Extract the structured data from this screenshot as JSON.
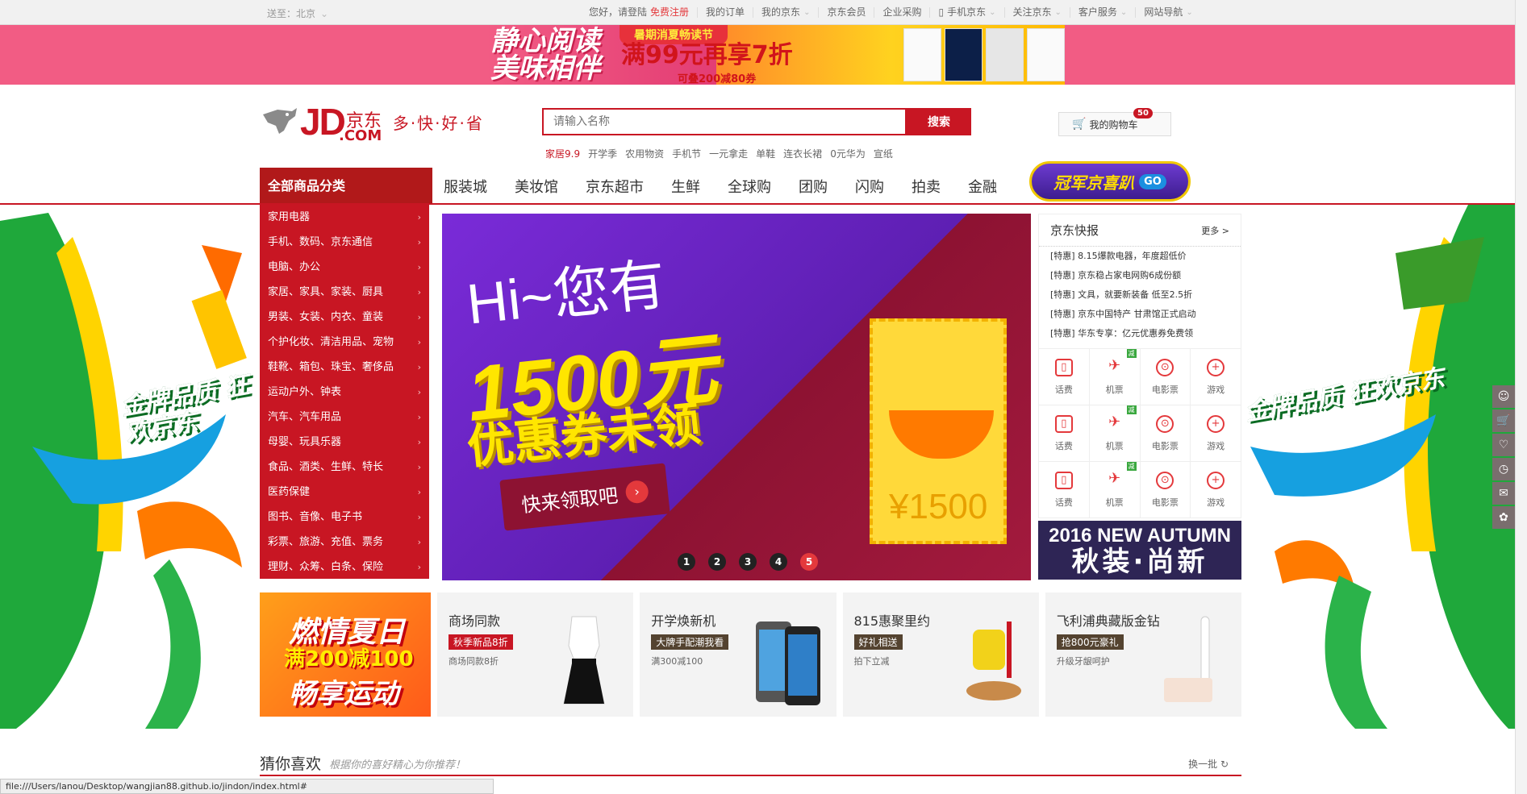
{
  "topbar": {
    "location_label": "送至：北京",
    "greeting": "您好，请登陆",
    "register": "免费注册",
    "items": [
      "我的订单",
      "我的京东",
      "京东会员",
      "企业采购",
      "手机京东",
      "关注京东",
      "客户服务",
      "网站导航"
    ]
  },
  "top_banner": {
    "line1": "静心阅读",
    "line2": "美味相伴",
    "badge": "暑期消夏畅读节",
    "offer": "满99元再享7折",
    "sub": "可叠200减80券"
  },
  "logo": {
    "mark": "JD",
    "cn": "京东",
    "com": ".COM",
    "slogan": "多·快·好·省"
  },
  "search": {
    "placeholder": "请输入名称",
    "button": "搜索"
  },
  "hotwords": [
    "家居9.9",
    "开学季",
    "农用物资",
    "手机节",
    "一元拿走",
    "单鞋",
    "连衣长裙",
    "0元华为",
    "宣纸"
  ],
  "cart": {
    "label": "我的购物车",
    "count": "50"
  },
  "nav": {
    "all_categories": "全部商品分类",
    "links": [
      "服装城",
      "美妆馆",
      "京东超市",
      "生鲜",
      "全球购",
      "团购",
      "闪购",
      "拍卖",
      "金融"
    ],
    "promo": "冠军京喜趴",
    "promo_go": "GO"
  },
  "side_deco": {
    "left": "金牌品质 狂欢京东",
    "right": "金牌品质 狂欢京东"
  },
  "categories": [
    "家用电器",
    "手机、数码、京东通信",
    "电脑、办公",
    "家居、家具、家装、厨具",
    "男装、女装、内衣、童装",
    "个护化妆、清洁用品、宠物",
    "鞋靴、箱包、珠宝、奢侈品",
    "运动户外、钟表",
    "汽车、汽车用品",
    "母婴、玩具乐器",
    "食品、酒类、生鲜、特长",
    "医药保健",
    "图书、音像、电子书",
    "彩票、旅游、充值、票务",
    "理财、众筹、白条、保险"
  ],
  "slider": {
    "line1": "Hi~您有",
    "line2": "1500元",
    "line3": "优惠券未领",
    "cta": "快来领取吧",
    "ticket_value": "¥1500",
    "dots": [
      "1",
      "2",
      "3",
      "4",
      "5"
    ],
    "active_dot": 5
  },
  "news": {
    "title": "京东快报",
    "more": "更多 >",
    "items": [
      "[特惠] 8.15爆款电器，年度超低价",
      "[特惠] 京东稳占家电网购6成份额",
      "[特惠] 文具，就要新装备 低至2.5折",
      "[特惠] 京东中国特产 甘肃馆正式启动",
      "[特惠] 华东专享：亿元优惠券免费领"
    ]
  },
  "services": [
    {
      "label": "话费",
      "icon": "phone-icon"
    },
    {
      "label": "机票",
      "icon": "plane-icon",
      "tag": "减"
    },
    {
      "label": "电影票",
      "icon": "film-icon"
    },
    {
      "label": "游戏",
      "icon": "gamepad-icon"
    },
    {
      "label": "话费",
      "icon": "phone-icon"
    },
    {
      "label": "机票",
      "icon": "plane-icon",
      "tag": "减"
    },
    {
      "label": "电影票",
      "icon": "film-icon"
    },
    {
      "label": "游戏",
      "icon": "gamepad-icon"
    },
    {
      "label": "话费",
      "icon": "phone-icon"
    },
    {
      "label": "机票",
      "icon": "plane-icon",
      "tag": "减"
    },
    {
      "label": "电影票",
      "icon": "film-icon"
    },
    {
      "label": "游戏",
      "icon": "gamepad-icon"
    }
  ],
  "autumn": {
    "line1": "2016 NEW AUTUMN",
    "line2": "秋装·尚新"
  },
  "promos": {
    "first": {
      "line1": "燃情夏日",
      "line2": "满200减100",
      "line3": "畅享运动"
    },
    "cards": [
      {
        "title": "商场同款",
        "tag": "秋季新品8折",
        "sub": "商场同款8折",
        "style": "red"
      },
      {
        "title": "开学焕新机",
        "tag": "大牌手配潮我看",
        "sub": "满300减100",
        "style": "dark"
      },
      {
        "title": "815惠聚里约",
        "tag": "好礼相送",
        "sub": "拍下立减",
        "style": "dark"
      },
      {
        "title": "飞利浦典藏版金钻",
        "tag": "抢800元豪礼",
        "sub": "升级牙龈呵护",
        "style": "dark"
      }
    ]
  },
  "guess": {
    "title": "猜你喜欢",
    "subtitle": "根据你的喜好精心为你推荐！",
    "refresh": "换一批"
  },
  "status_url": "file:///Users/lanou/Desktop/wangjian88.github.io/jindon/index.html#",
  "colors": {
    "brand_red": "#c81623",
    "accent_red": "#e4393c",
    "banner_pink": "#f25c84"
  }
}
